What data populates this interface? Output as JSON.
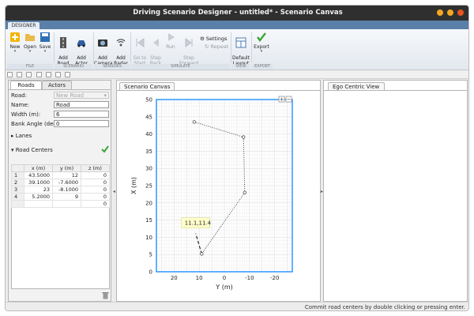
{
  "window": {
    "title": "Driving Scenario Designer - untitled* - Scenario Canvas"
  },
  "toolstrip": {
    "tab": "DESIGNER",
    "buttons": {
      "new": "New",
      "open": "Open",
      "save": "Save",
      "add_road": "Add\nRoad",
      "add_actor": "Add\nActor",
      "add_camera": "Add\nCamera",
      "add_radar": "Add\nRadar",
      "go_to_start": "Go to\nStart",
      "step_back": "Step\nBack",
      "run": "Run",
      "step_forward": "Step\nForward",
      "settings": "Settings",
      "repeat": "Repeat",
      "default_layout": "Default\nLayout",
      "export": "Export"
    },
    "groups": {
      "file": "FILE",
      "scenario": "SCENARIO",
      "sensors": "SENSORS",
      "simulate": "SIMULATE",
      "view": "VIEW",
      "export": "EXPORT"
    }
  },
  "left_panel": {
    "tabs": [
      "Roads",
      "Actors"
    ],
    "road_label": "Road:",
    "road_select": "New Road",
    "name_label": "Name:",
    "name_value": "Road",
    "width_label": "Width (m):",
    "width_value": "6",
    "bank_label": "Bank Angle (deg):",
    "bank_value": "0",
    "lanes_label": "▸ Lanes",
    "road_centers_label": "▾ Road Centers",
    "table": {
      "columns": [
        "x (m)",
        "y (m)",
        "z (m)"
      ],
      "rows": [
        {
          "idx": "1",
          "x": "43.5000",
          "y": "12",
          "z": "0"
        },
        {
          "idx": "2",
          "x": "39.1000",
          "y": "-7.6000",
          "z": "0"
        },
        {
          "idx": "3",
          "x": "23",
          "y": "-8.1000",
          "z": "0"
        },
        {
          "idx": "4",
          "x": "5.2000",
          "y": "9",
          "z": "0"
        },
        {
          "idx": "",
          "x": "",
          "y": "",
          "z": "0"
        }
      ]
    }
  },
  "canvas_panel": {
    "title": "Scenario Canvas",
    "tooltip": "11.1,11.4"
  },
  "ego_panel": {
    "title": "Ego Centric View"
  },
  "status": {
    "text": "Commit road centers by double clicking or pressing enter."
  },
  "chart_data": {
    "type": "line",
    "xlabel": "Y (m)",
    "ylabel": "X (m)",
    "x_axis": "Y (m), reversed",
    "y_axis": "X (m)",
    "xlim": [
      27,
      -27
    ],
    "ylim": [
      0,
      50
    ],
    "xticks": [
      20,
      10,
      0,
      -10,
      -20
    ],
    "yticks": [
      0,
      5,
      10,
      15,
      20,
      25,
      30,
      35,
      40,
      45,
      50
    ],
    "grid": true,
    "series": [
      {
        "points": [
          {
            "x_m": 43.5,
            "y_m": 12
          },
          {
            "x_m": 39.1,
            "y_m": -7.6
          },
          {
            "x_m": 23,
            "y_m": -8.1
          },
          {
            "x_m": 5.2,
            "y_m": 9
          }
        ]
      }
    ],
    "pending_segment": {
      "from": {
        "x_m": 5.2,
        "y_m": 9
      },
      "to": {
        "x_m": 11.1,
        "y_m": 11.4
      }
    },
    "tooltip": "11.1,11.4",
    "colors": {
      "frame": "#1e90ff",
      "road": "#333333",
      "tooltip_bg": "#ffffcc"
    }
  }
}
